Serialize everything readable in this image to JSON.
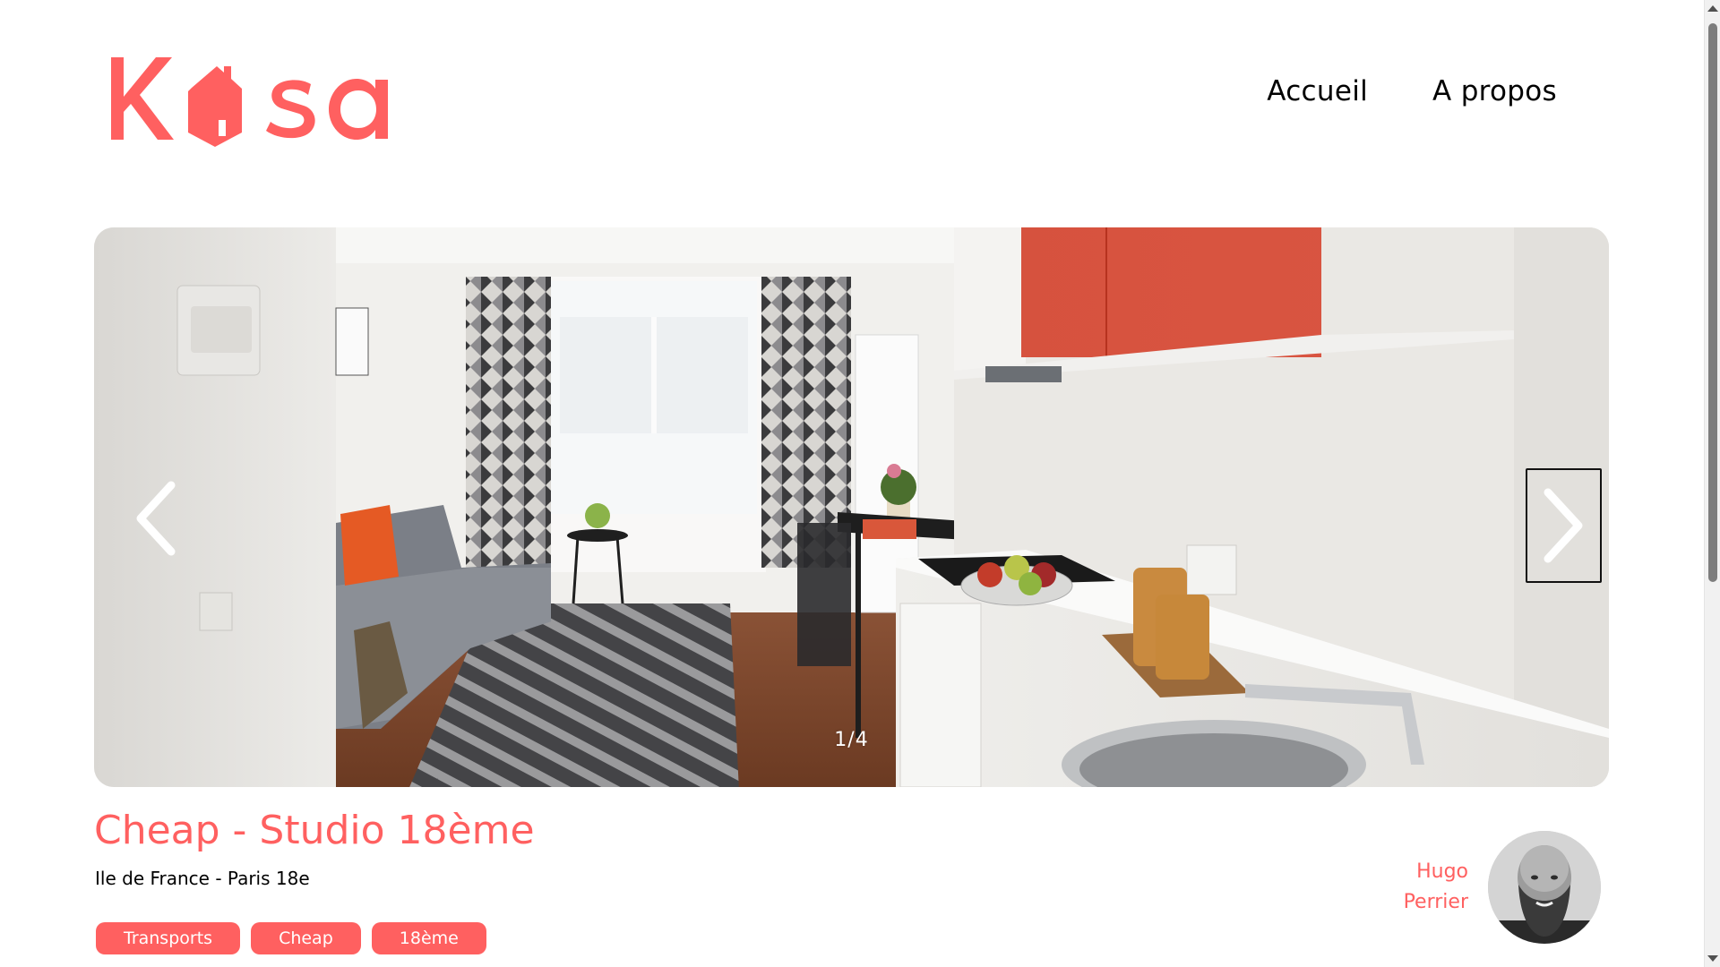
{
  "brand": {
    "logo_text": "Kasa",
    "accent_color": "#ff6060"
  },
  "nav": {
    "items": [
      {
        "label": "Accueil"
      },
      {
        "label": "A propos"
      }
    ]
  },
  "gallery": {
    "counter": "1/4",
    "prev_icon": "chevron-left-icon",
    "next_icon": "chevron-right-icon"
  },
  "listing": {
    "title": "Cheap - Studio 18ème",
    "location": "Ile de France - Paris 18e",
    "tags": [
      "Transports",
      "Cheap",
      "18ème"
    ],
    "host": {
      "first_name": "Hugo",
      "last_name": "Perrier"
    }
  }
}
